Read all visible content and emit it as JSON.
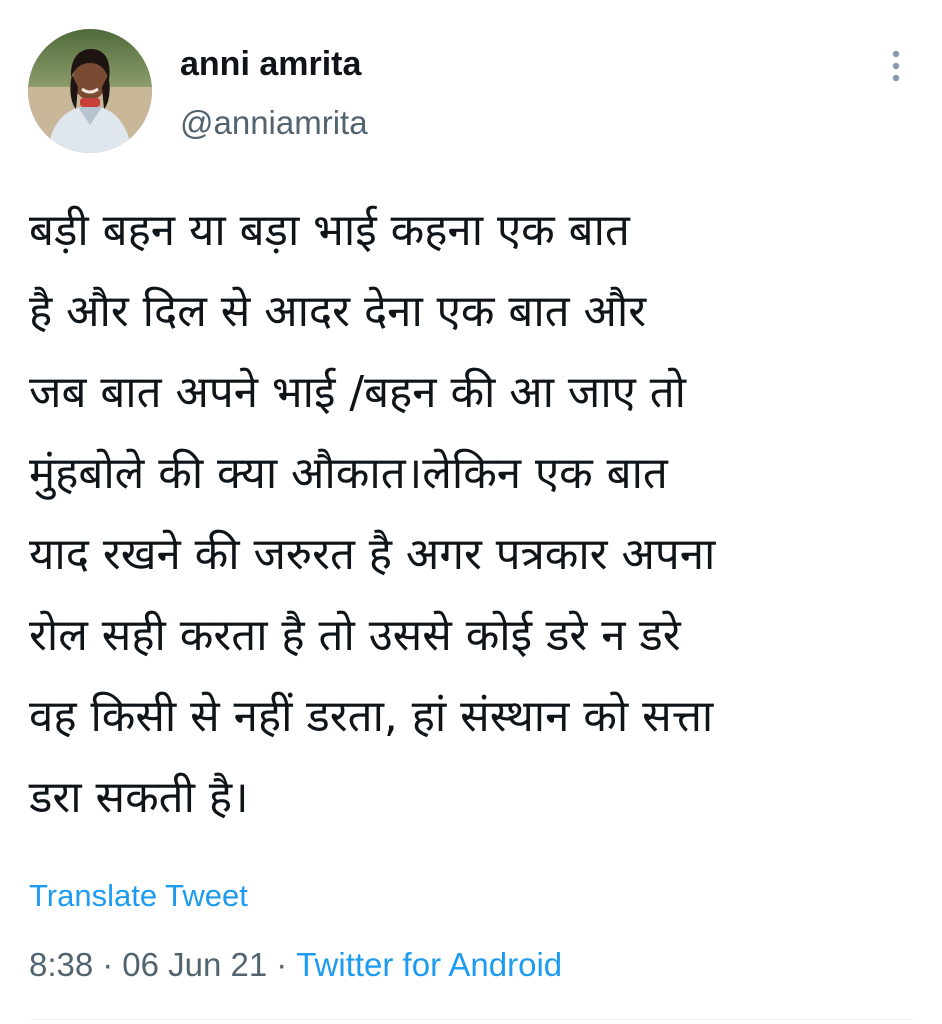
{
  "user": {
    "display_name": "anni amrita",
    "handle": "@anniamrita",
    "avatar_icon": "profile-photo"
  },
  "more_icon": "more-vertical-icon",
  "tweet": {
    "lines": [
      "बड़ी बहन या बड़ा भाई कहना एक बात",
      "है और दिल से आदर देना एक बात और",
      "जब बात अपने भाई /बहन की आ जाए तो",
      "मुंहबोले की क्या औकात।लेकिन एक बात",
      "याद रखने की जरुरत है अगर पत्रकार अपना",
      "रोल सही करता है तो उससे कोई डरे न डरे",
      "वह किसी से नहीं डरता, हां संस्थान को सत्ता",
      "डरा सकती है।"
    ]
  },
  "translate_label": "Translate Tweet",
  "meta": {
    "time": "8:38",
    "separator": "·",
    "date": "06 Jun 21",
    "source": "Twitter for Android"
  },
  "colors": {
    "link": "#1d9bf0",
    "secondary_text": "#536471",
    "primary_text": "#0f1419",
    "background": "#ffffff"
  }
}
